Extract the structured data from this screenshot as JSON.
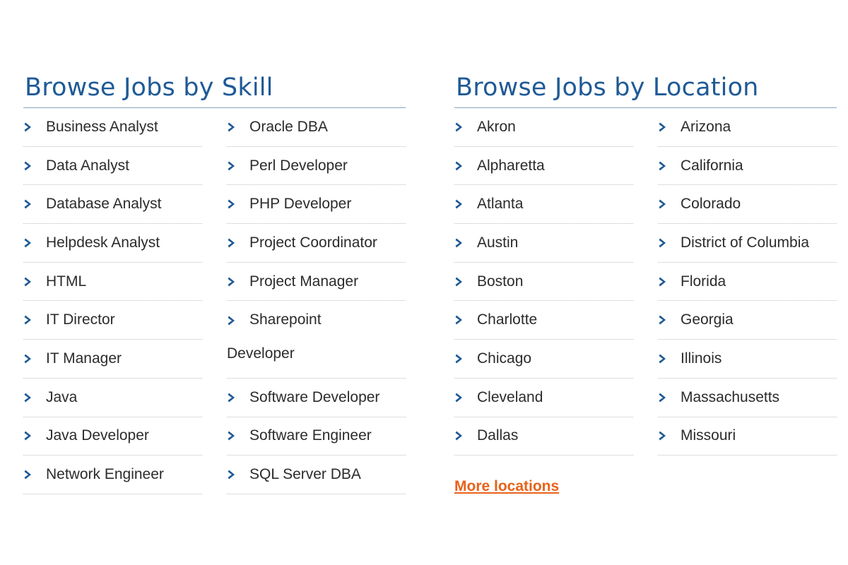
{
  "colors": {
    "heading": "#1f5a96",
    "chevron": "#1f5a96",
    "link": "#e8621a",
    "text": "#2b2b2b"
  },
  "skill": {
    "title": "Browse Jobs by Skill",
    "left": [
      "Business Analyst",
      "Data Analyst",
      "Database Analyst",
      "Helpdesk Analyst",
      "HTML",
      "IT Director",
      "IT Manager",
      "Java",
      "Java Developer",
      "Network Engineer"
    ],
    "right": [
      "Oracle DBA",
      "Perl Developer",
      "PHP Developer",
      "Project Coordinator",
      "Project Manager",
      "Sharepoint Developer",
      "Software Developer",
      "Software Engineer",
      "SQL Server DBA"
    ],
    "sharepoint_line1": "Sharepoint",
    "sharepoint_line2": "Developer"
  },
  "location": {
    "title": "Browse Jobs by Location",
    "left": [
      "Akron",
      "Alpharetta",
      "Atlanta",
      "Austin",
      "Boston",
      "Charlotte",
      "Chicago",
      "Cleveland",
      "Dallas"
    ],
    "right": [
      "Arizona",
      "California",
      "Colorado",
      "District of Columbia",
      "Florida",
      "Georgia",
      "Illinois",
      "Massachusetts",
      "Missouri"
    ],
    "more_label": "More locations"
  },
  "icons": {
    "item": "chevron-right-icon"
  }
}
